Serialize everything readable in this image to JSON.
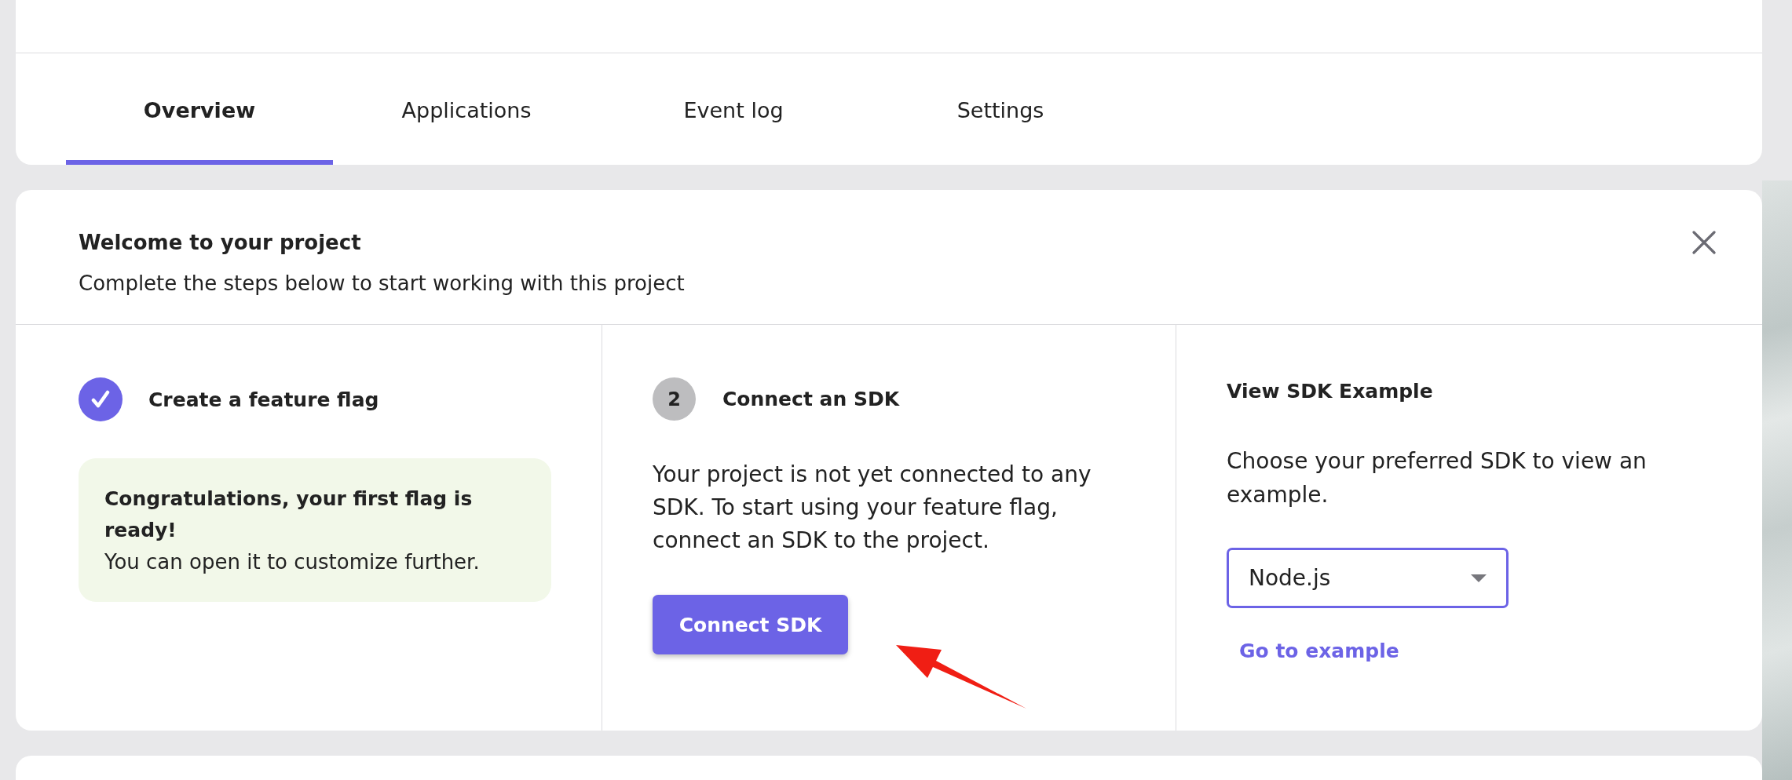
{
  "tabs": [
    {
      "label": "Overview",
      "selected": true
    },
    {
      "label": "Applications",
      "selected": false
    },
    {
      "label": "Event log",
      "selected": false
    },
    {
      "label": "Settings",
      "selected": false
    }
  ],
  "welcome": {
    "title": "Welcome to your project",
    "subtitle": "Complete the steps below to start working with this project",
    "steps": [
      {
        "title": "Create a feature flag",
        "completed": true,
        "notice": {
          "title": "Congratulations, your first flag is ready!",
          "message": "You can open it to customize further."
        }
      },
      {
        "number": "2",
        "title": "Connect an SDK",
        "completed": false,
        "description": "Your project is not yet connected to any SDK. To start using your feature flag, connect an SDK to the project.",
        "button": "Connect SDK"
      }
    ],
    "example": {
      "title": "View SDK Example",
      "description": "Choose your preferred SDK to view an example.",
      "sdk_select": {
        "value": "Node.js",
        "focused": true
      },
      "link": "Go to example"
    }
  },
  "annotations": [
    {
      "kind": "arrow"
    }
  ]
}
